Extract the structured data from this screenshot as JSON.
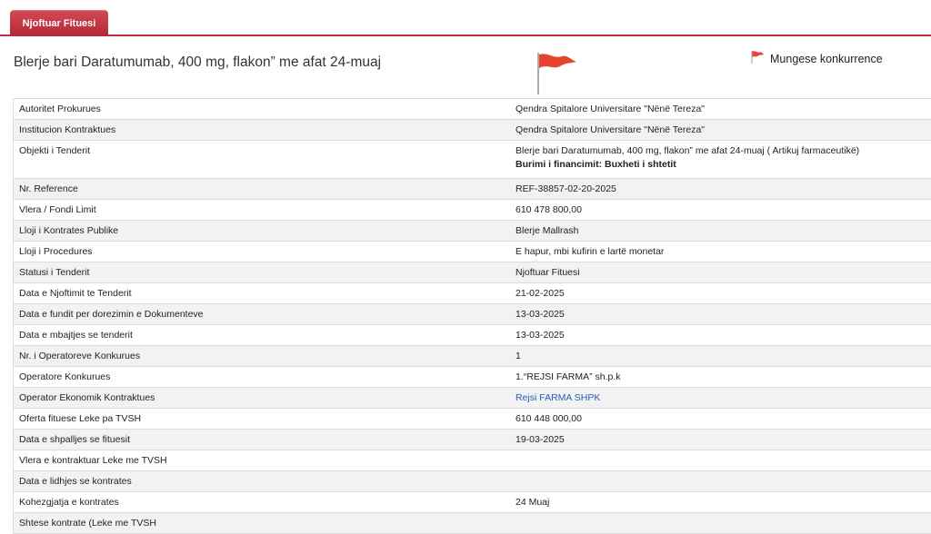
{
  "tabs": [
    {
      "label": "Njoftuar Fituesi",
      "active": true
    }
  ],
  "page": {
    "title": "Blerje bari Daratumumab, 400 mg, flakon” me afat 24-muaj",
    "legend_label": "Mungese konkurrence",
    "flag_color": "#e8432f"
  },
  "rows": [
    {
      "label": "Autoritet Prokurues",
      "value": "Qendra Spitalore Universitare \"Nënë Tereza\""
    },
    {
      "label": "Institucion Kontraktues",
      "value": "Qendra Spitalore Universitare \"Nënë Tereza\""
    },
    {
      "label": "Objekti i Tenderit",
      "value": "Blerje bari Daratumumab, 400 mg, flakon” me afat 24-muaj ( Artikuj farmaceutikë)",
      "value2": "Burimi i financimit: Buxheti i shtetit"
    },
    {
      "label": "Nr. Reference",
      "value": "REF-38857-02-20-2025"
    },
    {
      "label": "Vlera / Fondi Limit",
      "value": "610 478 800,00"
    },
    {
      "label": "Lloji i Kontrates Publike",
      "value": "Blerje Mallrash"
    },
    {
      "label": "Lloji i Procedures",
      "value": "E hapur, mbi kufirin e lartë monetar"
    },
    {
      "label": "Statusi i Tenderit",
      "value": "Njoftuar Fituesi"
    },
    {
      "label": "Data e Njoftimit te Tenderit",
      "value": "21-02-2025"
    },
    {
      "label": "Data e fundit per dorezimin e Dokumenteve",
      "value": "13-03-2025"
    },
    {
      "label": "Data e mbajtjes se tenderit",
      "value": "13-03-2025"
    },
    {
      "label": "Nr. i Operatoreve Konkurues",
      "value": "1"
    },
    {
      "label": "Operatore Konkurues",
      "value": "1.“REJSI FARMA” sh.p.k"
    },
    {
      "label": "Operator Ekonomik Kontraktues",
      "value": "Rejsi FARMA SHPK",
      "is_link": true
    },
    {
      "label": "Oferta fituese Leke pa TVSH",
      "value": "610 448 000,00"
    },
    {
      "label": "Data e shpalljes se fituesit",
      "value": "19-03-2025"
    },
    {
      "label": "Vlera e kontraktuar Leke me TVSH",
      "value": ""
    },
    {
      "label": "Data e lidhjes se kontrates",
      "value": ""
    },
    {
      "label": "Kohezgjatja e kontrates",
      "value": "24 Muaj"
    },
    {
      "label": "Shtese kontrate (Leke me TVSH",
      "value": ""
    }
  ]
}
